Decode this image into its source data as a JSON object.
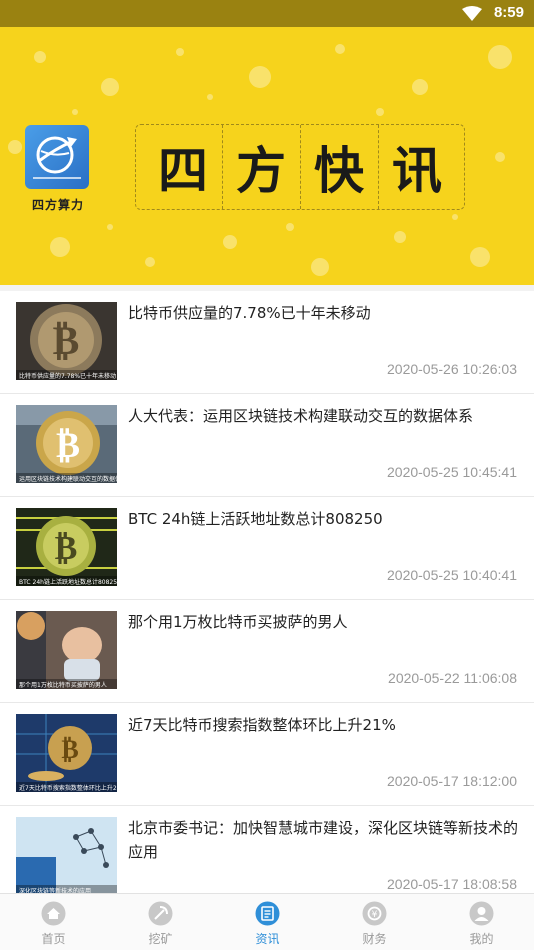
{
  "status_bar": {
    "time": "8:59"
  },
  "banner": {
    "logo_label": "四方算力",
    "title_chars": [
      "四",
      "方",
      "快",
      "讯"
    ]
  },
  "news": [
    {
      "title": "比特币供应量的7.78%已十年未移动",
      "date": "2020-05-26 10:26:03",
      "thumb_caption": "比特币供应量的7.78%已十年未移动"
    },
    {
      "title": "人大代表：运用区块链技术构建联动交互的数据体系",
      "date": "2020-05-25 10:45:41",
      "thumb_caption": "运用区块链技术构建联动交互的数据体系"
    },
    {
      "title": "BTC 24h链上活跃地址数总计808250",
      "date": "2020-05-25 10:40:41",
      "thumb_caption": "BTC 24h链上活跃地址数总计808250"
    },
    {
      "title": "那个用1万枚比特币买披萨的男人",
      "date": "2020-05-22 11:06:08",
      "thumb_caption": "那个用1万枚比特币买披萨的男人"
    },
    {
      "title": "近7天比特币搜索指数整体环比上升21%",
      "date": "2020-05-17 18:12:00",
      "thumb_caption": "近7天比特币搜索指数整体环比上升21%"
    },
    {
      "title": "北京市委书记：加快智慧城市建设，深化区块链等新技术的应用",
      "date": "2020-05-17 18:08:58",
      "thumb_caption": "深化区块链等新技术的应用"
    }
  ],
  "tabs": [
    {
      "label": "首页",
      "icon": "home-icon",
      "active": false
    },
    {
      "label": "挖矿",
      "icon": "mining-icon",
      "active": false
    },
    {
      "label": "资讯",
      "icon": "news-icon",
      "active": true
    },
    {
      "label": "财务",
      "icon": "finance-icon",
      "active": false
    },
    {
      "label": "我的",
      "icon": "profile-icon",
      "active": false
    }
  ],
  "colors": {
    "banner_yellow": "#f6d31c",
    "status_bar": "#9a8211",
    "active_tab": "#2f8fd8",
    "inactive_tab": "#9a9a9a"
  }
}
